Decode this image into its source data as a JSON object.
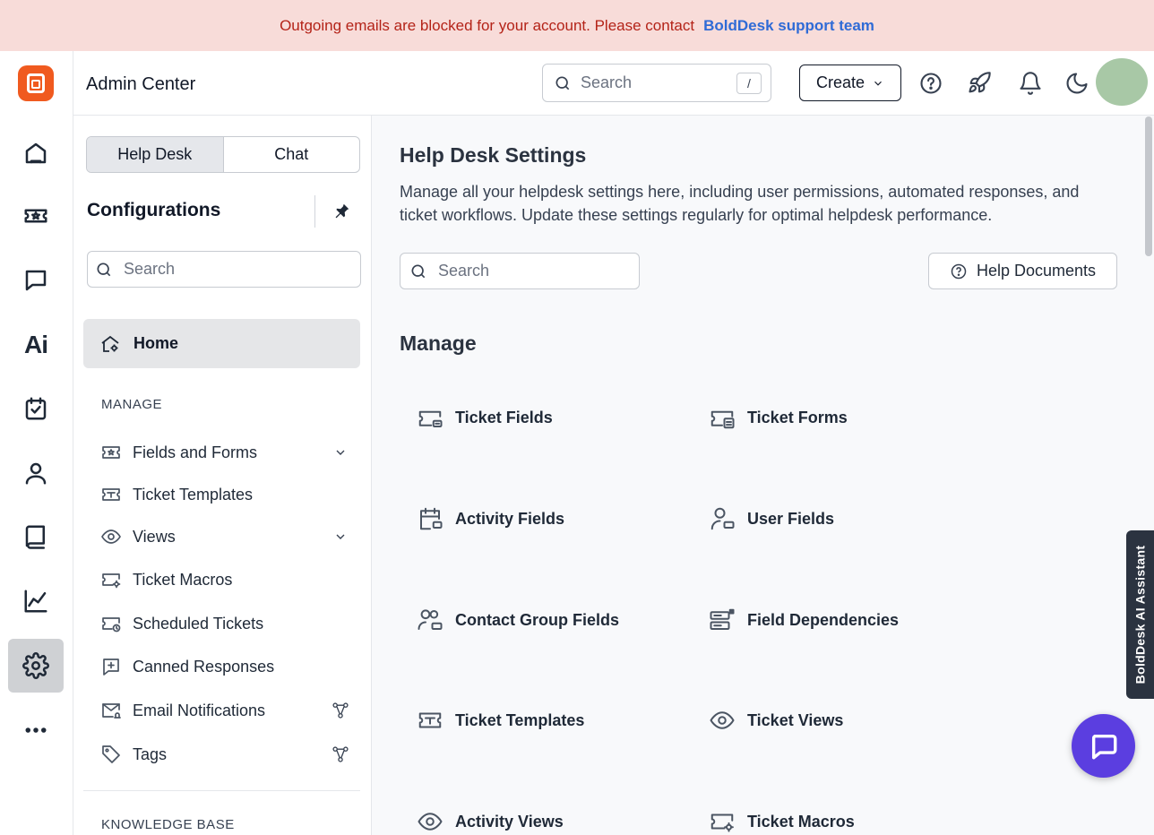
{
  "banner": {
    "message": "Outgoing emails are blocked for your account. Please contact",
    "link": "BoldDesk support team"
  },
  "rail": {
    "items": [
      "home-icon",
      "ticket-icon",
      "chat-icon",
      "ai-icon",
      "task-icon",
      "contacts-icon",
      "knowledge-base-icon",
      "reports-icon",
      "settings-icon",
      "more-icon"
    ],
    "ai_label": "Ai",
    "active": "settings-icon"
  },
  "header": {
    "title": "Admin Center",
    "search_placeholder": "Search",
    "search_shortcut": "/",
    "create_label": "Create"
  },
  "panel": {
    "tabs": [
      {
        "label": "Help Desk",
        "active": true
      },
      {
        "label": "Chat",
        "active": false
      }
    ],
    "title": "Configurations",
    "search_placeholder": "Search",
    "home_label": "Home",
    "sections": [
      {
        "label": "MANAGE"
      },
      {
        "label": "KNOWLEDGE BASE"
      }
    ],
    "items": [
      {
        "label": "Fields and Forms",
        "icon": "ticket-star-icon",
        "expandable": true
      },
      {
        "label": "Ticket Templates",
        "icon": "ticket-template-icon"
      },
      {
        "label": "Views",
        "icon": "eye-icon",
        "expandable": true
      },
      {
        "label": "Ticket Macros",
        "icon": "ticket-macro-icon"
      },
      {
        "label": "Scheduled Tickets",
        "icon": "scheduled-ticket-icon"
      },
      {
        "label": "Canned Responses",
        "icon": "canned-response-icon"
      },
      {
        "label": "Email Notifications",
        "icon": "email-notification-icon",
        "workflow": true
      },
      {
        "label": "Tags",
        "icon": "tag-icon",
        "workflow": true
      }
    ]
  },
  "main": {
    "title": "Help Desk Settings",
    "description": "Manage all your helpdesk settings here, including user permissions, automated responses, and ticket workflows. Update these settings regularly for optimal helpdesk performance.",
    "search_placeholder": "Search",
    "help_documents_label": "Help Documents",
    "manage_heading": "Manage",
    "cards": [
      {
        "label": "Ticket Fields",
        "icon": "ticket-fields-icon"
      },
      {
        "label": "Ticket Forms",
        "icon": "ticket-forms-icon"
      },
      {
        "label": "Activity Fields",
        "icon": "activity-fields-icon"
      },
      {
        "label": "User Fields",
        "icon": "user-fields-icon"
      },
      {
        "label": "Contact Group Fields",
        "icon": "contact-group-fields-icon"
      },
      {
        "label": "Field Dependencies",
        "icon": "field-dependencies-icon"
      },
      {
        "label": "Ticket Templates",
        "icon": "ticket-template-icon"
      },
      {
        "label": "Ticket Views",
        "icon": "eye-icon"
      },
      {
        "label": "Activity Views",
        "icon": "eye-icon"
      },
      {
        "label": "Ticket Macros",
        "icon": "ticket-macro-icon"
      }
    ]
  },
  "assistant_tab": "BoldDesk AI Assistant",
  "colors": {
    "banner_bg": "#f8dcd9",
    "banner_text": "#b42318",
    "link": "#2f6bd6",
    "brand": "#f05a1f",
    "chat_fab": "#5b3ee0"
  }
}
